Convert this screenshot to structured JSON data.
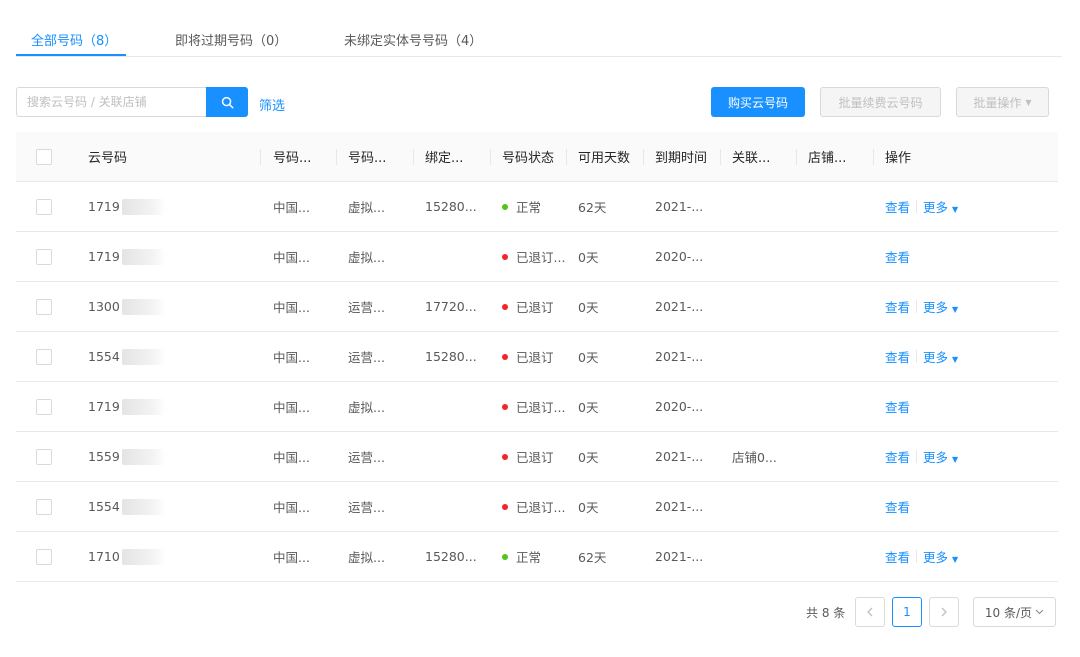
{
  "tabs": [
    {
      "label": "全部号码（8）",
      "active": true
    },
    {
      "label": "即将过期号码（0）",
      "active": false
    },
    {
      "label": "未绑定实体号号码（4）",
      "active": false
    }
  ],
  "toolbar": {
    "search_placeholder": "搜索云号码 / 关联店铺",
    "search_icon": "search-icon",
    "filter_label": "筛选",
    "buy_label": "购买云号码",
    "renew_label": "批量续费云号码",
    "batch_label": "批量操作"
  },
  "table": {
    "columns": [
      "云号码",
      "号码...",
      "号码...",
      "绑定...",
      "号码状态",
      "可用天数",
      "到期时间",
      "关联...",
      "店铺...",
      "操作"
    ],
    "rows": [
      {
        "num_prefix": "1719",
        "num_tail": "",
        "carrier": "中国...",
        "type": "虚拟...",
        "bound": "15280...",
        "status": "正常",
        "status_color": "#52c41a",
        "days": "62天",
        "expire": "2021-...",
        "assoc": "",
        "shop": "",
        "view": "查看",
        "more": "更多"
      },
      {
        "num_prefix": "1719",
        "num_tail": "",
        "carrier": "中国...",
        "type": "虚拟...",
        "bound": "",
        "status": "已退订...",
        "status_color": "#f5222d",
        "days": "0天",
        "expire": "2020-...",
        "assoc": "",
        "shop": "",
        "view": "查看",
        "more": ""
      },
      {
        "num_prefix": "1300",
        "num_tail": "",
        "carrier": "中国...",
        "type": "运营...",
        "bound": "17720...",
        "status": "已退订",
        "status_color": "#f5222d",
        "days": "0天",
        "expire": "2021-...",
        "assoc": "",
        "shop": "",
        "view": "查看",
        "more": "更多"
      },
      {
        "num_prefix": "1554",
        "num_tail": "",
        "carrier": "中国...",
        "type": "运营...",
        "bound": "15280...",
        "status": "已退订",
        "status_color": "#f5222d",
        "days": "0天",
        "expire": "2021-...",
        "assoc": "",
        "shop": "",
        "view": "查看",
        "more": "更多"
      },
      {
        "num_prefix": "1719",
        "num_tail": "",
        "carrier": "中国...",
        "type": "虚拟...",
        "bound": "",
        "status": "已退订...",
        "status_color": "#f5222d",
        "days": "0天",
        "expire": "2020-...",
        "assoc": "",
        "shop": "",
        "view": "查看",
        "more": ""
      },
      {
        "num_prefix": "1559",
        "num_tail": "",
        "carrier": "中国...",
        "type": "运营...",
        "bound": "",
        "status": "已退订",
        "status_color": "#f5222d",
        "days": "0天",
        "expire": "2021-...",
        "assoc": "店铺0...",
        "shop": "",
        "view": "查看",
        "more": "更多"
      },
      {
        "num_prefix": "1554",
        "num_tail": "",
        "carrier": "中国...",
        "type": "运营...",
        "bound": "",
        "status": "已退订...",
        "status_color": "#f5222d",
        "days": "0天",
        "expire": "2021-...",
        "assoc": "",
        "shop": "",
        "view": "查看",
        "more": ""
      },
      {
        "num_prefix": "1710",
        "num_tail": "",
        "carrier": "中国...",
        "type": "虚拟...",
        "bound": "15280...",
        "status": "正常",
        "status_color": "#52c41a",
        "days": "62天",
        "expire": "2021-...",
        "assoc": "",
        "shop": "",
        "view": "查看",
        "more": "更多"
      }
    ]
  },
  "pagination": {
    "total": "共 8 条",
    "prev_icon": "chevron-left-icon",
    "current": "1",
    "next_icon": "chevron-right-icon",
    "page_size": "10 条/页"
  },
  "colors": {
    "accent": "#1890ff",
    "status_normal": "#52c41a",
    "status_cancelled": "#f5222d"
  }
}
